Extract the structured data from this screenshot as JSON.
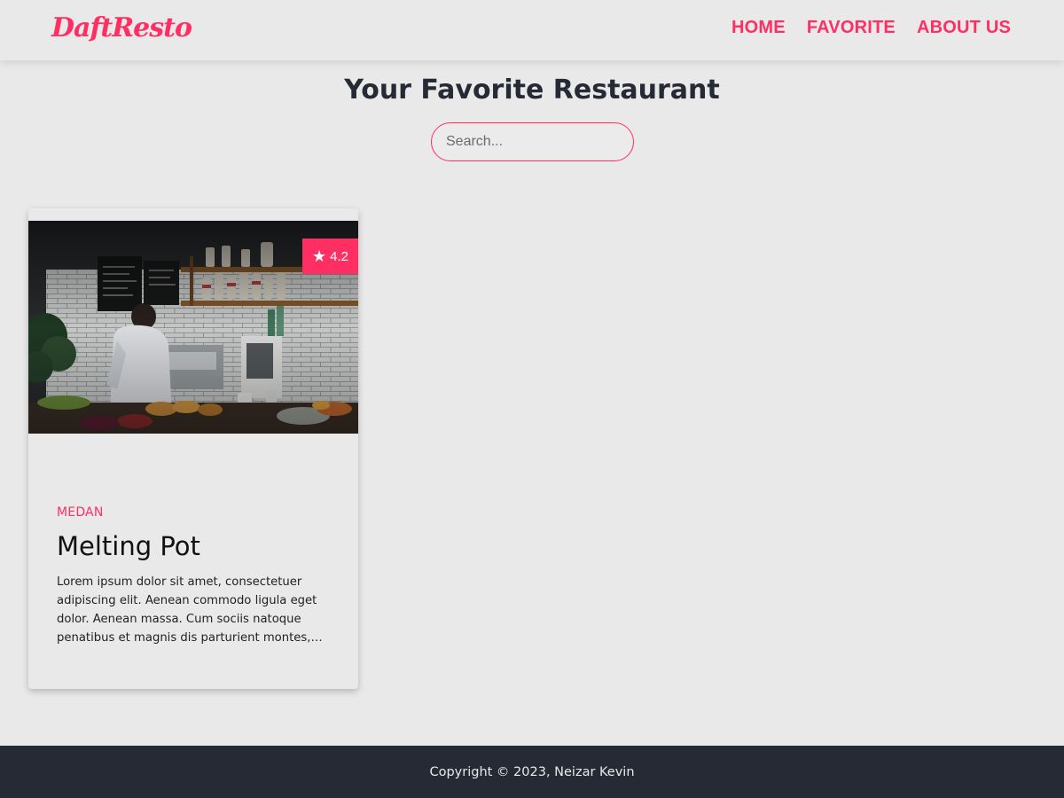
{
  "header": {
    "brand": "DaftResto",
    "nav": [
      {
        "label": "HOME"
      },
      {
        "label": "FAVORITE"
      },
      {
        "label": "ABOUT US"
      }
    ]
  },
  "main": {
    "title": "Your Favorite Restaurant",
    "search": {
      "placeholder": "Search...",
      "value": ""
    },
    "restaurants": [
      {
        "rating": "4.2",
        "city": "MEDAN",
        "name": "Melting Pot",
        "description": "Lorem ipsum dolor sit amet, consectetuer adipiscing elit. Aenean commodo ligula eget dolor. Aenean massa. Cum sociis natoque penatibus et magnis dis parturient montes, nascetur ridiculus mus.",
        "image_icon": "restaurant-photo",
        "rating_icon": "star-icon"
      }
    ]
  },
  "footer": {
    "copyright": "Copyright © 2023, Neizar Kevin"
  },
  "colors": {
    "accent": "#ff2e63",
    "background": "#e9e9e9",
    "dark": "#252a34"
  }
}
